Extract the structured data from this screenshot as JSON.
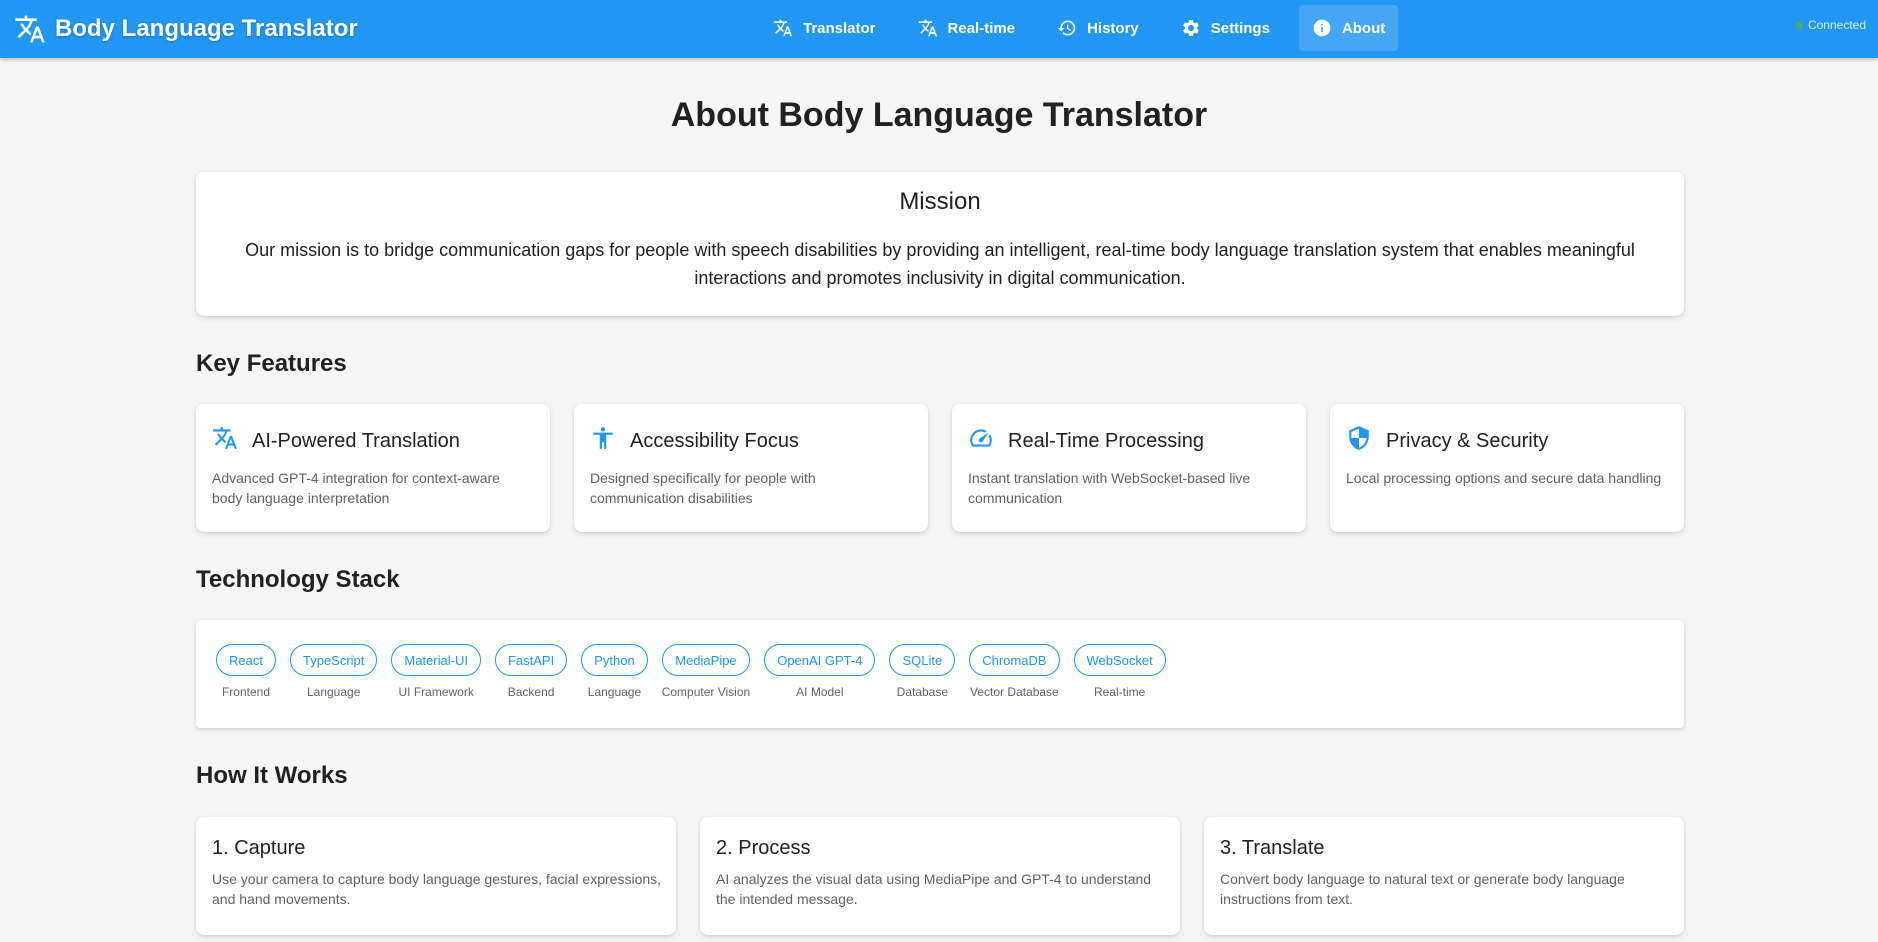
{
  "app": {
    "title": "Body Language Translator",
    "status": "Connected",
    "colors": {
      "primary": "#2196f3",
      "status": "#4caf50"
    }
  },
  "nav": [
    {
      "label": "Translator",
      "icon": "translate-icon"
    },
    {
      "label": "Real-time",
      "icon": "translate-icon"
    },
    {
      "label": "History",
      "icon": "history-icon"
    },
    {
      "label": "Settings",
      "icon": "gear-icon"
    },
    {
      "label": "About",
      "icon": "info-icon",
      "active": true
    }
  ],
  "page": {
    "title": "About Body Language Translator"
  },
  "mission": {
    "title": "Mission",
    "text": "Our mission is to bridge communication gaps for people with speech disabilities by providing an intelligent, real-time body language translation system that enables meaningful interactions and promotes inclusivity in digital communication."
  },
  "features": {
    "heading": "Key Features",
    "items": [
      {
        "title": "AI-Powered Translation",
        "desc": "Advanced GPT-4 integration for context-aware body language interpretation",
        "icon": "translate-icon"
      },
      {
        "title": "Accessibility Focus",
        "desc": "Designed specifically for people with communication disabilities",
        "icon": "accessibility-icon"
      },
      {
        "title": "Real-Time Processing",
        "desc": "Instant translation with WebSocket-based live communication",
        "icon": "speed-icon"
      },
      {
        "title": "Privacy & Security",
        "desc": "Local processing options and secure data handling",
        "icon": "shield-icon"
      }
    ]
  },
  "tech": {
    "heading": "Technology Stack",
    "items": [
      {
        "name": "React",
        "label": "Frontend"
      },
      {
        "name": "TypeScript",
        "label": "Language"
      },
      {
        "name": "Material-UI",
        "label": "UI Framework"
      },
      {
        "name": "FastAPI",
        "label": "Backend"
      },
      {
        "name": "Python",
        "label": "Language"
      },
      {
        "name": "MediaPipe",
        "label": "Computer Vision"
      },
      {
        "name": "OpenAI GPT-4",
        "label": "AI Model"
      },
      {
        "name": "SQLite",
        "label": "Database"
      },
      {
        "name": "ChromaDB",
        "label": "Vector Database"
      },
      {
        "name": "WebSocket",
        "label": "Real-time"
      }
    ]
  },
  "how": {
    "heading": "How It Works",
    "steps": [
      {
        "title": "1. Capture",
        "desc": "Use your camera to capture body language gestures, facial expressions, and hand movements."
      },
      {
        "title": "2. Process",
        "desc": "AI analyzes the visual data using MediaPipe and GPT-4 to understand the intended message."
      },
      {
        "title": "3. Translate",
        "desc": "Convert body language to natural text or generate body language instructions from text."
      }
    ]
  }
}
